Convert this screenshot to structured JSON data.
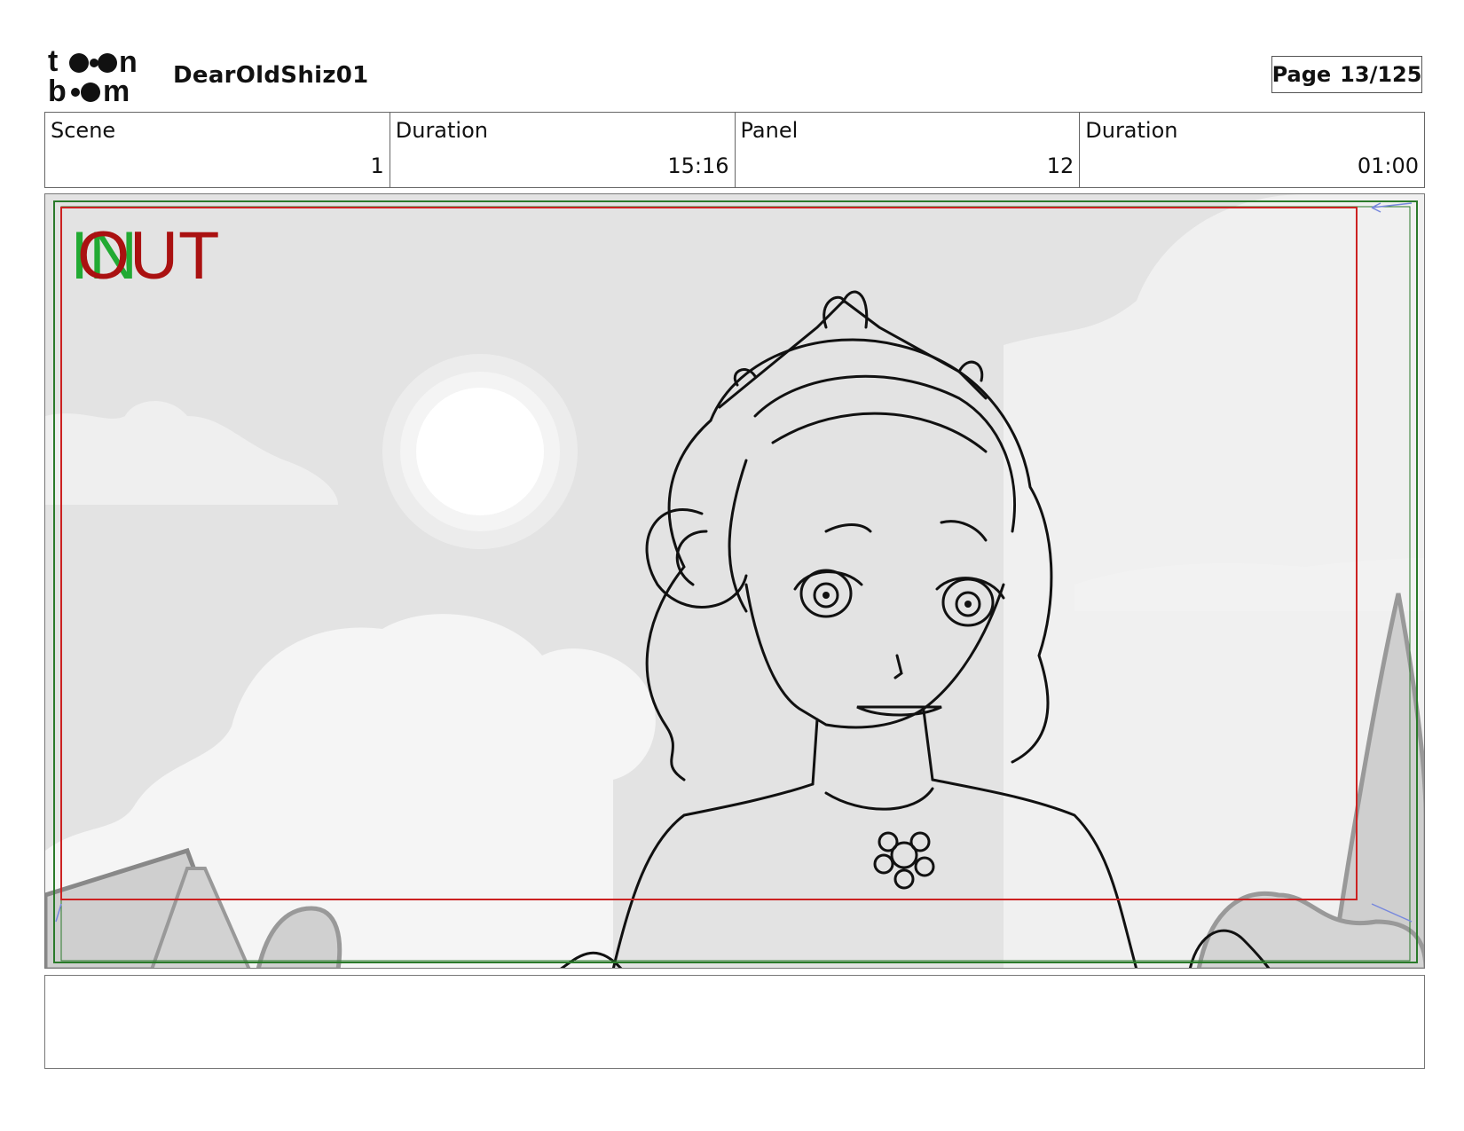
{
  "header": {
    "logo_text_top": "toon",
    "logo_text_bottom": "boom",
    "project_title": "DearOldShiz01",
    "page_label": "Page",
    "page_value": "13/125"
  },
  "info": {
    "scene_label": "Scene",
    "scene_value": "1",
    "scene_duration_label": "Duration",
    "scene_duration_value": "15:16",
    "panel_label": "Panel",
    "panel_value": "12",
    "panel_duration_label": "Duration",
    "panel_duration_value": "01:00"
  },
  "panel": {
    "in_marker": "IN",
    "out_marker": "OUT",
    "colors": {
      "safe_frame": "#cc2222",
      "camera_frame": "#2a7a2a",
      "in_text": "#22aa33",
      "out_text": "#aa1111"
    }
  },
  "notes": {
    "text": ""
  }
}
